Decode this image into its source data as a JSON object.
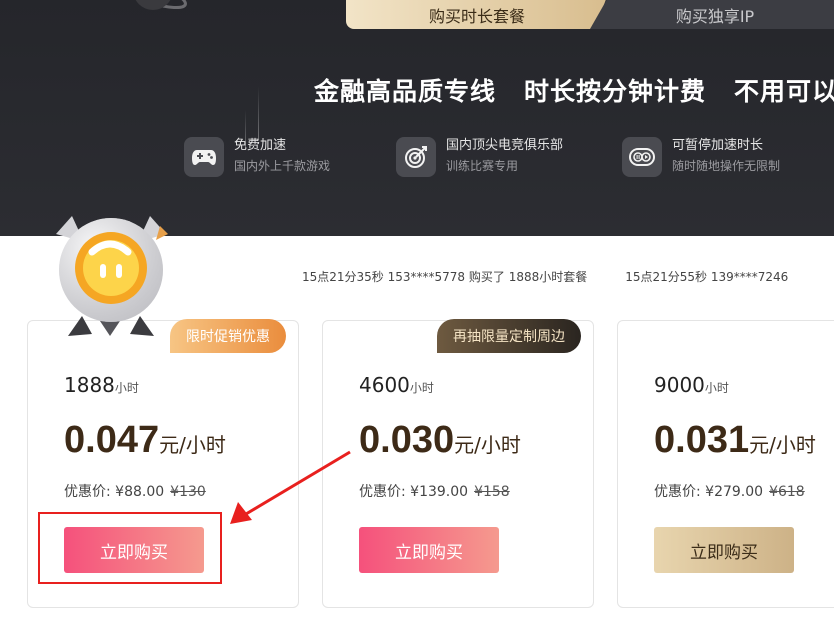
{
  "tabs": [
    {
      "label": "购买时长套餐",
      "active": true
    },
    {
      "label": "购买独享IP",
      "active": false
    }
  ],
  "slogan": [
    "金融高品质专线",
    "时长按分钟计费",
    "不用可以"
  ],
  "features": [
    {
      "icon": "gamepad-icon",
      "title": "免费加速",
      "sub": "国内外上千款游戏"
    },
    {
      "icon": "target-icon",
      "title": "国内顶尖电竞俱乐部",
      "sub": "训练比赛专用"
    },
    {
      "icon": "pause-play-icon",
      "title": "可暂停加速时长",
      "sub": "随时随地操作无限制"
    }
  ],
  "ticker": [
    "15点21分35秒  153****5778  购买了  1888小时套餐",
    "15点21分55秒  139****7246"
  ],
  "cards": [
    {
      "badge": "限时促销优惠",
      "hours": "1888",
      "hours_unit": "小时",
      "price": "0.047",
      "price_unit": "元/小时",
      "disc_label": "优惠价: ",
      "disc_price": "¥88.00",
      "orig_price": "¥130",
      "buy_label": "立即购买"
    },
    {
      "badge": "再抽限量定制周边",
      "hours": "4600",
      "hours_unit": "小时",
      "price": "0.030",
      "price_unit": "元/小时",
      "disc_label": "优惠价: ",
      "disc_price": "¥139.00",
      "orig_price": "¥158",
      "buy_label": "立即购买"
    },
    {
      "badge": "",
      "hours": "9000",
      "hours_unit": "小时",
      "price": "0.031",
      "price_unit": "元/小时",
      "disc_label": "优惠价: ",
      "disc_price": "¥279.00",
      "orig_price": "¥618",
      "buy_label": "立即购买"
    }
  ],
  "colors": {
    "accent_pink": "#f5517c",
    "accent_gold": "#d8bd8e",
    "annotation_red": "#e8201e",
    "header_bg": "#26272c"
  }
}
